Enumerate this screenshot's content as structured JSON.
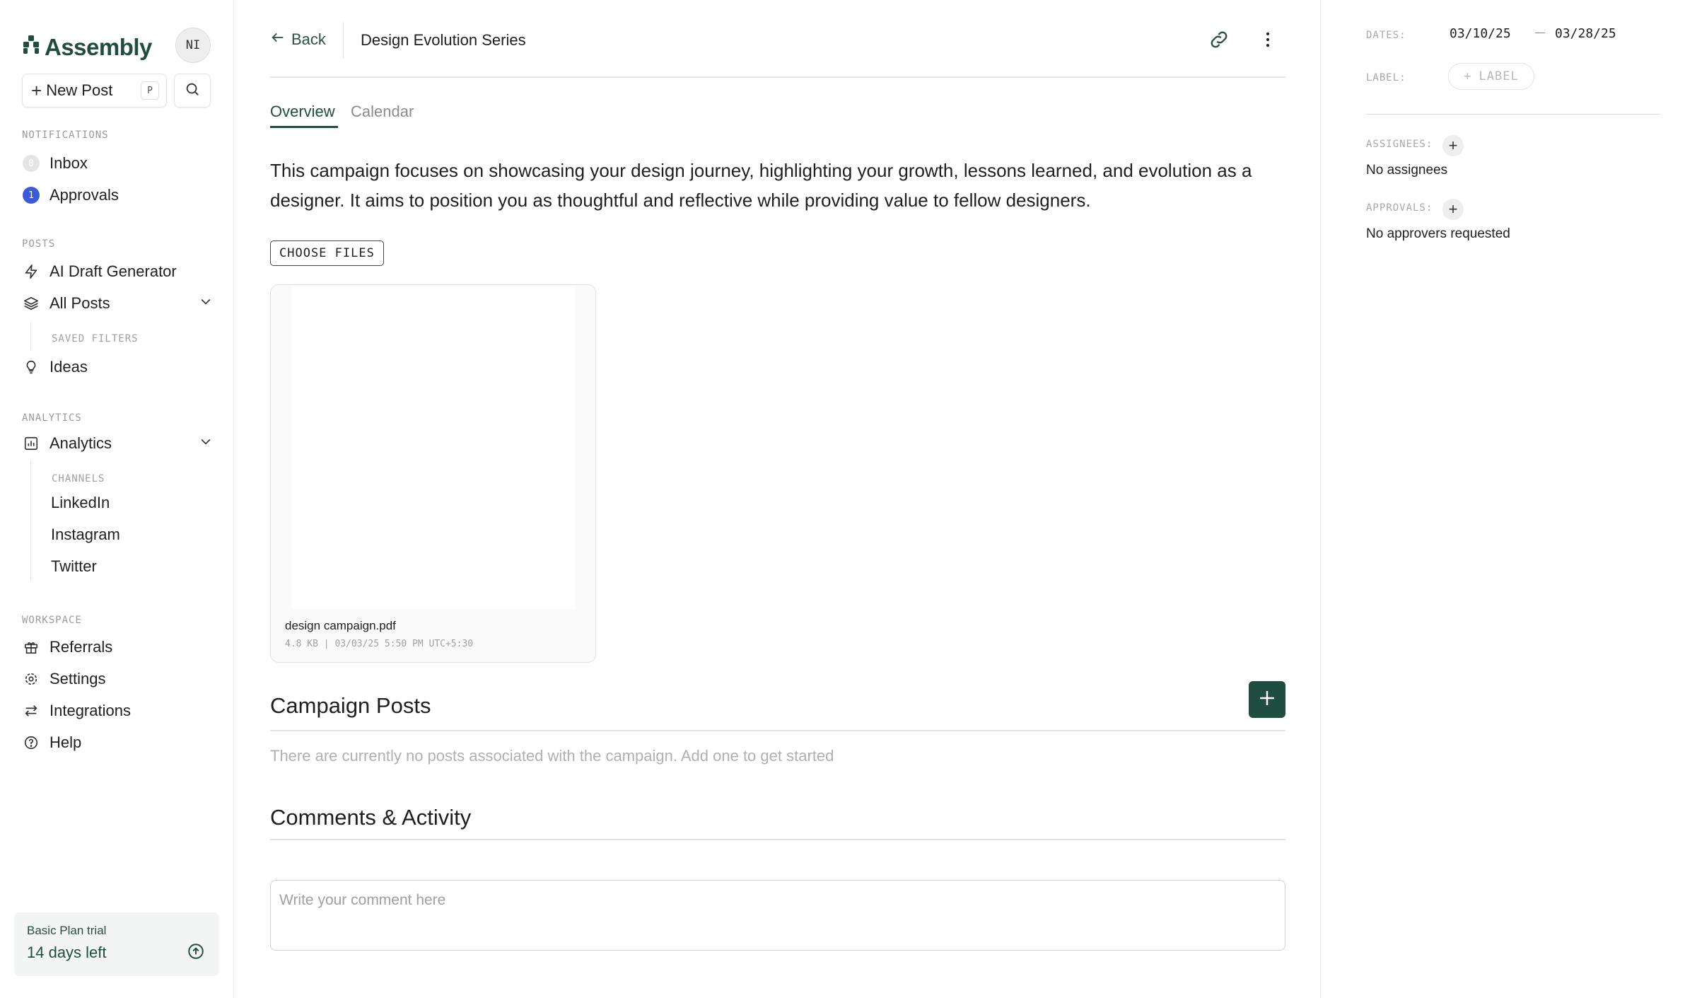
{
  "sidebar": {
    "brand": "Assembly",
    "avatar_initials": "NI",
    "new_post_label": "New Post",
    "new_post_shortcut": "P",
    "sections": {
      "notifications": "NOTIFICATIONS",
      "posts": "POSTS",
      "analytics": "ANALYTICS",
      "workspace": "WORKSPACE"
    },
    "inbox": {
      "label": "Inbox",
      "count": "0"
    },
    "approvals": {
      "label": "Approvals",
      "count": "1"
    },
    "ai_draft": "AI Draft Generator",
    "all_posts": "All Posts",
    "saved_filters": "SAVED FILTERS",
    "ideas": "Ideas",
    "analytics": "Analytics",
    "channels_title": "CHANNELS",
    "channels": [
      "LinkedIn",
      "Instagram",
      "Twitter"
    ],
    "referrals": "Referrals",
    "settings": "Settings",
    "integrations": "Integrations",
    "help": "Help",
    "trial": {
      "plan": "Basic Plan trial",
      "days_left": "14 days left"
    }
  },
  "header": {
    "back_label": "Back",
    "title": "Design Evolution Series"
  },
  "tabs": {
    "overview": "Overview",
    "calendar": "Calendar"
  },
  "campaign": {
    "description": "This campaign focuses on showcasing your design journey, highlighting your growth, lessons learned, and evolution as a designer. It aims to position you as thoughtful and reflective while providing value to fellow designers.",
    "choose_files": "CHOOSE FILES",
    "file": {
      "name": "design campaign.pdf",
      "meta": "4.8 KB | 03/03/25 5:50 PM UTC+5:30"
    },
    "posts_heading": "Campaign Posts",
    "posts_empty": "There are currently no posts associated with the campaign. Add one to get started",
    "comments_heading": "Comments & Activity",
    "comment_placeholder": "Write your comment here"
  },
  "details": {
    "dates_label": "DATES:",
    "start_date": "03/10/25",
    "end_date": "03/28/25",
    "label_label": "LABEL:",
    "label_button": "LABEL",
    "assignees_label": "ASSIGNEES:",
    "assignees_empty": "No assignees",
    "approvals_label": "APPROVALS:",
    "approvals_empty": "No approvers requested"
  },
  "colors": {
    "brand": "#1f4d3f",
    "badge_blue": "#3b5bdb"
  }
}
